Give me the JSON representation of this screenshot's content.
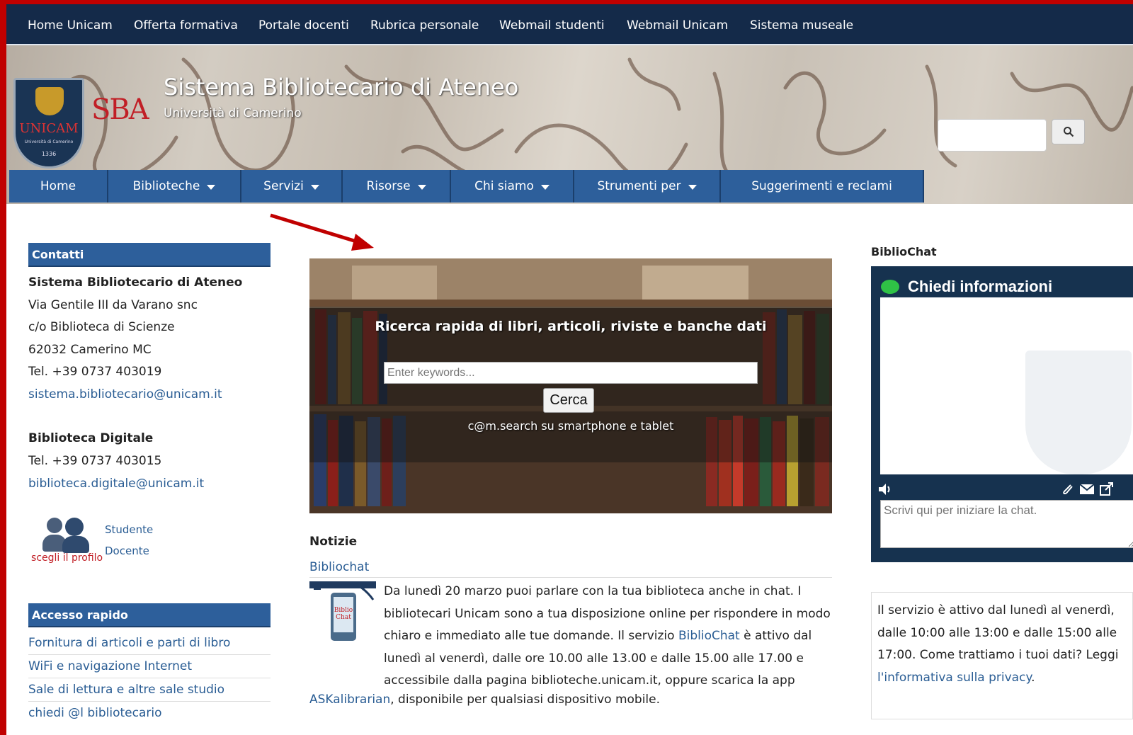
{
  "topbar": {
    "links": [
      "Home Unicam",
      "Offerta formativa",
      "Portale docenti",
      "Rubrica personale",
      "Webmail studenti",
      "Webmail Unicam",
      "Sistema museale"
    ]
  },
  "header": {
    "crest_text": "UNICAM",
    "crest_sub": "Università di Camerino",
    "crest_year": "1336",
    "logo_text": "SBA",
    "title": "Sistema Bibliotecario di Ateneo",
    "subtitle": "Università di Camerino",
    "search_placeholder": ""
  },
  "nav": {
    "items": [
      "Home",
      "Biblioteche",
      "Servizi",
      "Risorse",
      "Chi siamo",
      "Strumenti per",
      "Suggerimenti e reclami"
    ]
  },
  "contacts": {
    "heading": "Contatti",
    "org": "Sistema Bibliotecario di Ateneo",
    "lines": [
      "Via Gentile III da Varano snc",
      "c/o Biblioteca di Scienze",
      "62032 Camerino MC",
      "Tel. +39 0737 403019"
    ],
    "email": "sistema.bibliotecario@unicam.it",
    "digital_title": "Biblioteca Digitale",
    "digital_tel": "Tel. +39 0737 403015",
    "digital_email": "biblioteca.digitale@unicam.it"
  },
  "profile": {
    "label": "scegli il profilo",
    "student": "Studente",
    "teacher": "Docente"
  },
  "quick_access": {
    "heading": "Accesso rapido",
    "links": [
      "Fornitura di articoli e parti di libro",
      "WiFi e navigazione Internet",
      "Sale di lettura e altre sale studio",
      "chiedi @l bibliotecario"
    ]
  },
  "search": {
    "title": "Ricerca rapida di libri, articoli, riviste e banche dati",
    "placeholder": "Enter keywords...",
    "button": "Cerca",
    "mobile_note": "c@m.search su smartphone e tablet"
  },
  "news": {
    "heading": "Notizie",
    "item_title": "Bibliochat",
    "thumb_text": "Biblio Chat",
    "text_before": "Da lunedì 20 marzo puoi parlare con la tua biblioteca anche in chat. I bibliotecari Unicam sono a tua disposizione online per rispondere in modo chiaro e immediato alle tue domande. Il servizio ",
    "text_link": "BiblioChat",
    "text_after": " è attivo dal lunedì al venerdì, dalle ore 10.00 alle 13.00 e dalle 15.00 alle 17.00 e accessibile dalla pagina biblioteche.unicam.it, oppure scarica la app",
    "tail_link": "ASKalibrarian",
    "tail_text": ", disponibile per qualsiasi dispositivo mobile."
  },
  "chat": {
    "label": "BiblioChat",
    "header": "Chiedi informazioni",
    "input_placeholder": "Scrivi qui per iniziare la chat.",
    "info_text": "Il servizio è attivo dal lunedì al venerdì, dalle 10:00 alle 13:00 e dalle 15:00 alle 17:00. Come trattiamo i tuoi dati? Leggi ",
    "info_link": "l'informativa sulla privacy",
    "info_end": "."
  },
  "colors": {
    "topbar": "#142a49",
    "nav": "#2d5f9b",
    "link": "#2a5d94",
    "frame": "#c00000",
    "chat": "#16324f"
  }
}
